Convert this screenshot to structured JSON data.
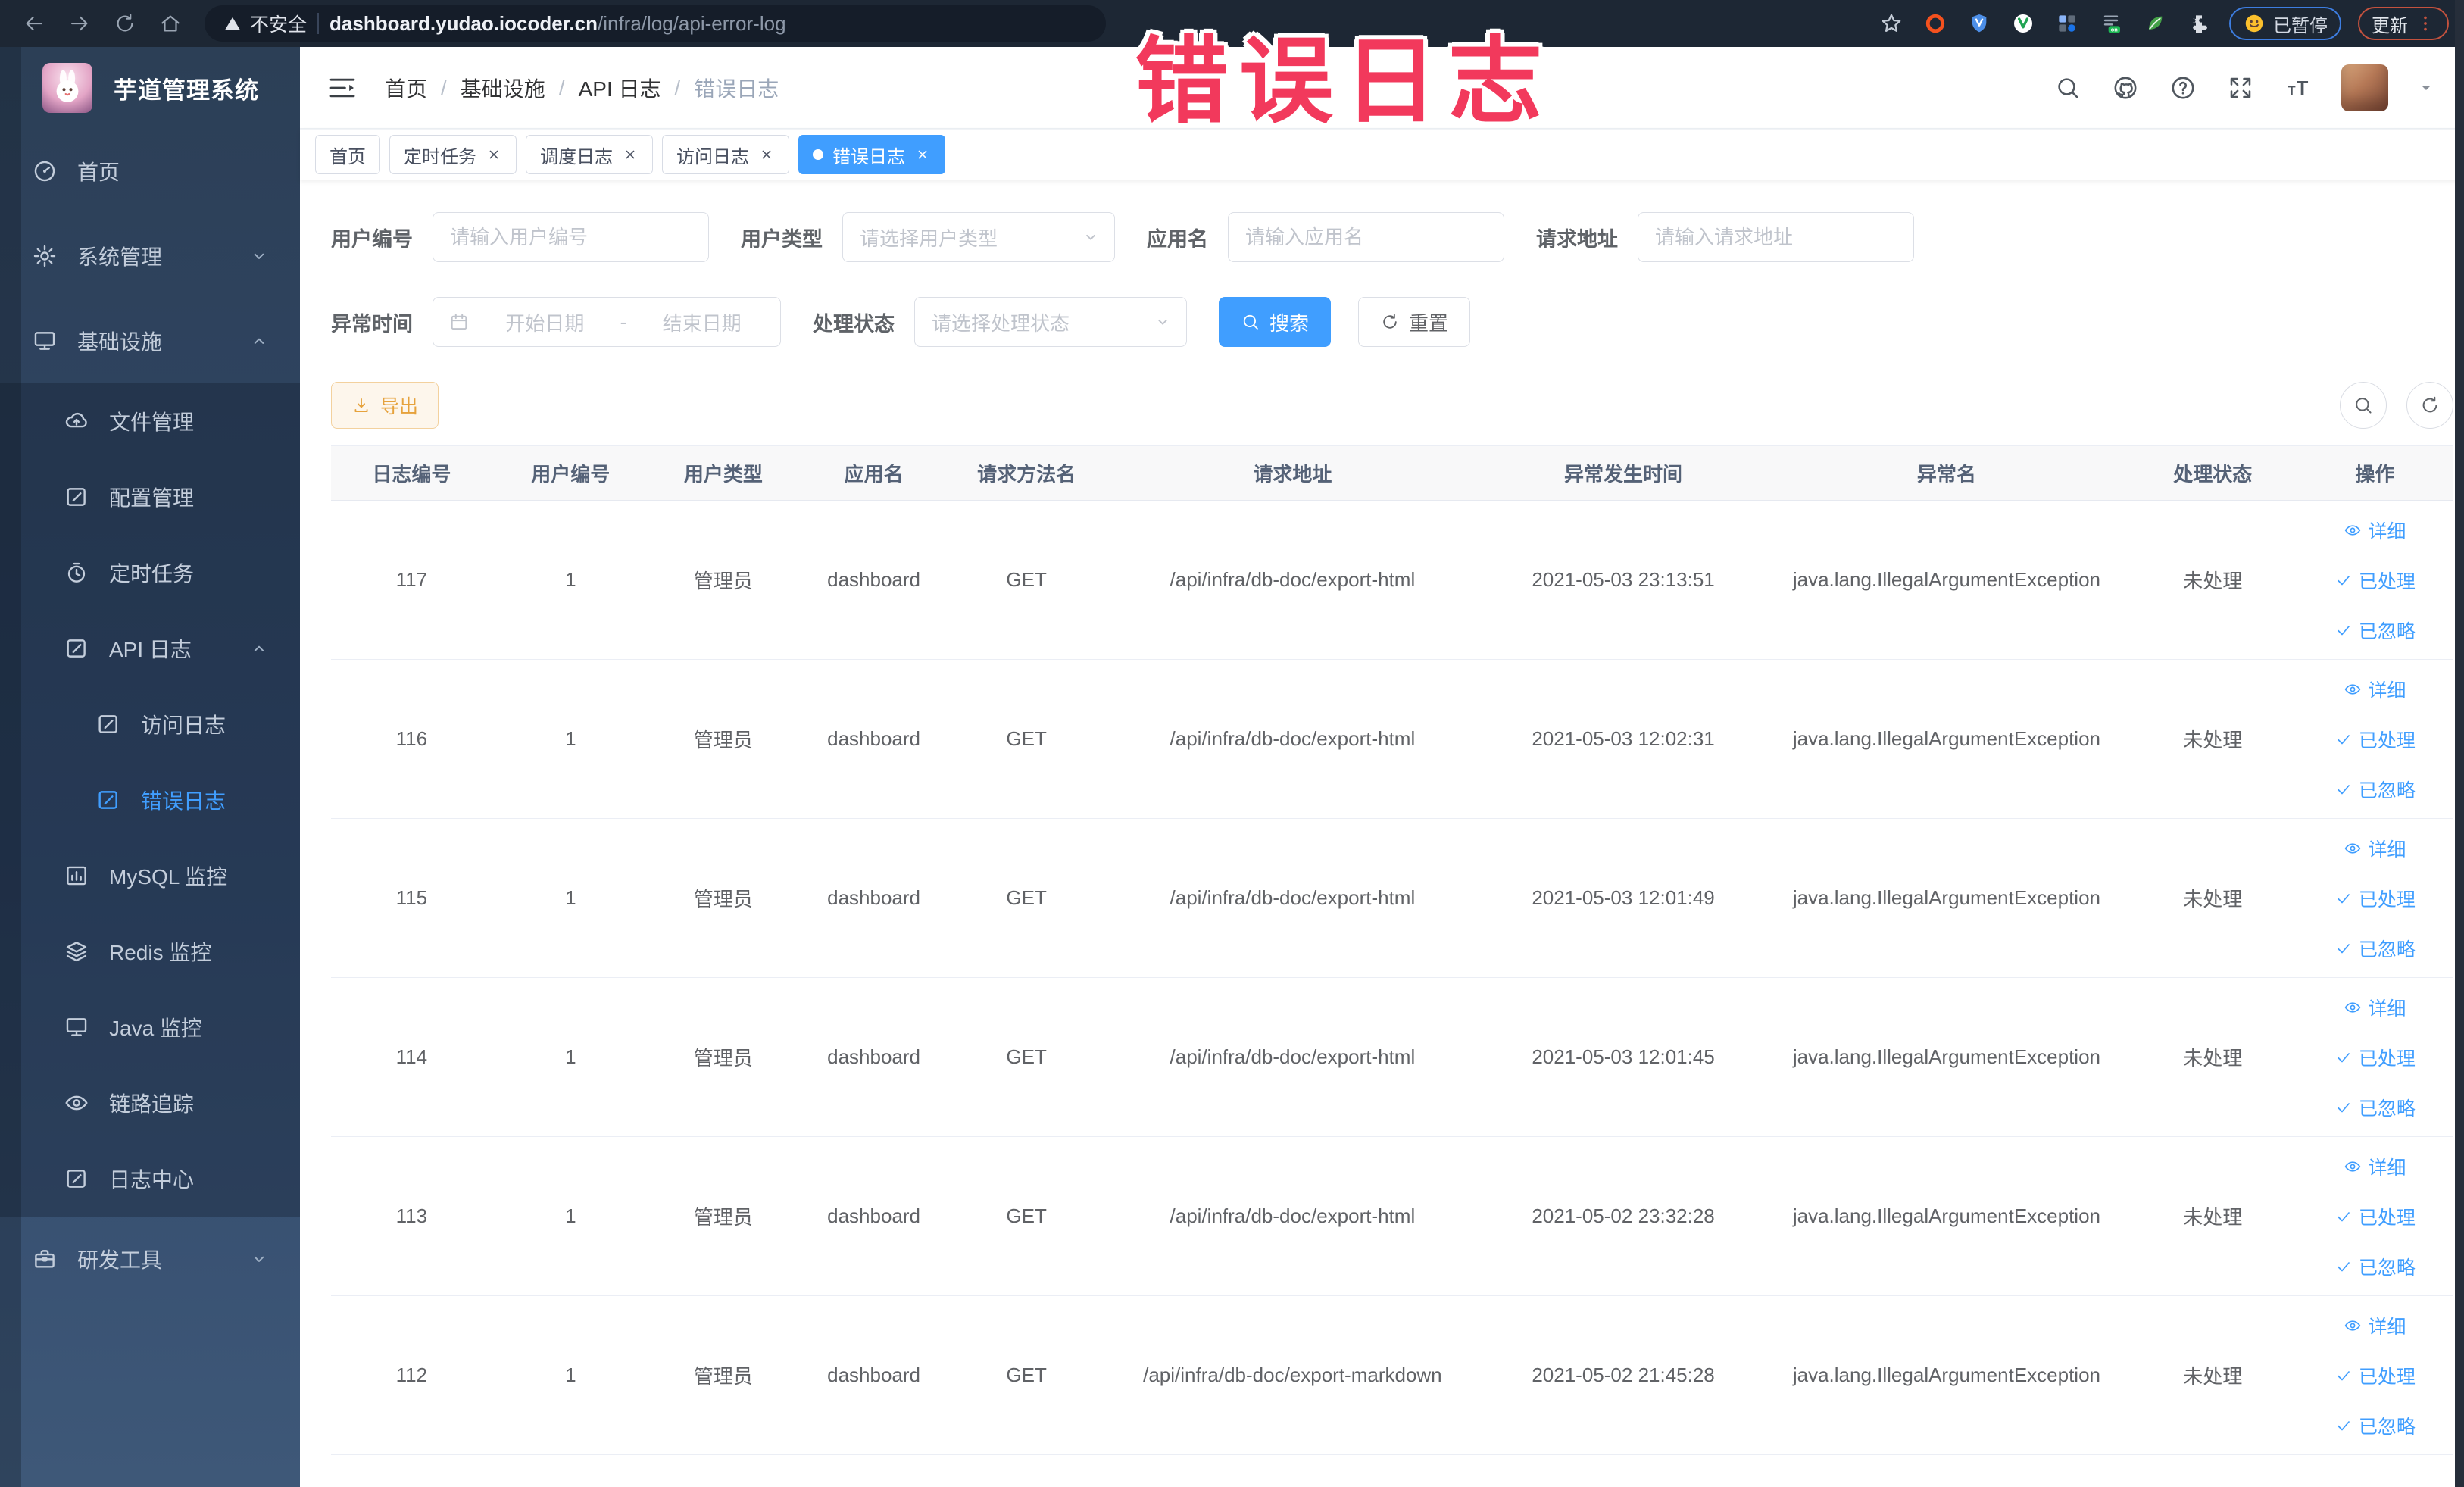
{
  "watermark": {
    "text": "错误日志",
    "color": "#f2395c"
  },
  "browser": {
    "nav_icons": [
      "back-icon",
      "forward-icon",
      "reload-icon",
      "home-icon"
    ],
    "security_label": "不安全",
    "url_domain": "dashboard.yudao.iocoder.cn",
    "url_path": "/infra/log/api-error-log",
    "extensions": [
      {
        "name": "extension-ring-icon",
        "style": "ring-orange"
      },
      {
        "name": "extension-shield-icon",
        "style": "shield-blue"
      },
      {
        "name": "extension-v-icon",
        "style": "circle-green-v"
      },
      {
        "name": "extension-grid-icon",
        "style": "grid-blue"
      },
      {
        "name": "extension-on-icon",
        "style": "on-badge"
      },
      {
        "name": "extension-leaf-icon",
        "style": "leaf-green"
      },
      {
        "name": "extension-puzzle-icon",
        "style": "puzzle-light"
      }
    ],
    "paused_label": "已暂停",
    "update_label": "更新"
  },
  "sidebar": {
    "title": "芋道管理系统",
    "items": [
      {
        "label": "首页",
        "icon": "home-icon",
        "level": 1
      },
      {
        "label": "系统管理",
        "icon": "gear-icon",
        "level": 1,
        "chevron": "down"
      },
      {
        "label": "基础设施",
        "icon": "monitor-icon",
        "level": 1,
        "chevron": "up"
      },
      {
        "label": "文件管理",
        "icon": "cloud-icon",
        "level": 2,
        "section": "sub"
      },
      {
        "label": "配置管理",
        "icon": "edit-icon",
        "level": 2,
        "section": "sub"
      },
      {
        "label": "定时任务",
        "icon": "timer-icon",
        "level": 2,
        "section": "sub"
      },
      {
        "label": "API 日志",
        "icon": "edit-icon",
        "level": 2,
        "section": "sub",
        "chevron": "up"
      },
      {
        "label": "访问日志",
        "icon": "edit-icon",
        "level": 3,
        "section": "sub"
      },
      {
        "label": "错误日志",
        "icon": "edit-icon",
        "level": 3,
        "section": "sub",
        "active": true
      },
      {
        "label": "MySQL 监控",
        "icon": "chart-icon",
        "level": 2,
        "section": "sub"
      },
      {
        "label": "Redis 监控",
        "icon": "layers-icon",
        "level": 2,
        "section": "sub"
      },
      {
        "label": "Java 监控",
        "icon": "monitor-icon",
        "level": 2,
        "section": "sub"
      },
      {
        "label": "链路追踪",
        "icon": "eye-icon",
        "level": 2,
        "section": "sub"
      },
      {
        "label": "日志中心",
        "icon": "edit-icon",
        "level": 2,
        "section": "sub"
      },
      {
        "label": "研发工具",
        "icon": "toolbox-icon",
        "level": 1,
        "chevron": "down"
      }
    ]
  },
  "topbar": {
    "breadcrumb": [
      "首页",
      "基础设施",
      "API 日志",
      "错误日志"
    ],
    "icons": [
      "search-icon",
      "github-icon",
      "help-icon",
      "fullscreen-icon",
      "font-size-icon"
    ]
  },
  "tags": [
    {
      "label": "首页",
      "closable": false,
      "active": false
    },
    {
      "label": "定时任务",
      "closable": true,
      "active": false
    },
    {
      "label": "调度日志",
      "closable": true,
      "active": false
    },
    {
      "label": "访问日志",
      "closable": true,
      "active": false
    },
    {
      "label": "错误日志",
      "closable": true,
      "active": true
    }
  ],
  "filters": {
    "user_id": {
      "label": "用户编号",
      "placeholder": "请输入用户编号"
    },
    "user_type": {
      "label": "用户类型",
      "placeholder": "请选择用户类型"
    },
    "app_name": {
      "label": "应用名",
      "placeholder": "请输入应用名"
    },
    "request_url": {
      "label": "请求地址",
      "placeholder": "请输入请求地址"
    },
    "exception_time": {
      "label": "异常时间",
      "start_placeholder": "开始日期",
      "separator": "-",
      "end_placeholder": "结束日期"
    },
    "process_status": {
      "label": "处理状态",
      "placeholder": "请选择处理状态"
    },
    "search_button": "搜索",
    "reset_button": "重置"
  },
  "toolbar": {
    "export_button": "导出"
  },
  "table": {
    "columns": [
      "日志编号",
      "用户编号",
      "用户类型",
      "应用名",
      "请求方法名",
      "请求地址",
      "异常发生时间",
      "异常名",
      "处理状态",
      "操作"
    ],
    "action_labels": {
      "detail": "详细",
      "processed": "已处理",
      "ignored": "已忽略"
    },
    "rows": [
      {
        "id": "117",
        "user_id": "1",
        "user_type": "管理员",
        "app": "dashboard",
        "method": "GET",
        "url": "/api/infra/db-doc/export-html",
        "time": "2021-05-03 23:13:51",
        "exception": "java.lang.IllegalArgumentException",
        "status": "未处理"
      },
      {
        "id": "116",
        "user_id": "1",
        "user_type": "管理员",
        "app": "dashboard",
        "method": "GET",
        "url": "/api/infra/db-doc/export-html",
        "time": "2021-05-03 12:02:31",
        "exception": "java.lang.IllegalArgumentException",
        "status": "未处理"
      },
      {
        "id": "115",
        "user_id": "1",
        "user_type": "管理员",
        "app": "dashboard",
        "method": "GET",
        "url": "/api/infra/db-doc/export-html",
        "time": "2021-05-03 12:01:49",
        "exception": "java.lang.IllegalArgumentException",
        "status": "未处理"
      },
      {
        "id": "114",
        "user_id": "1",
        "user_type": "管理员",
        "app": "dashboard",
        "method": "GET",
        "url": "/api/infra/db-doc/export-html",
        "time": "2021-05-03 12:01:45",
        "exception": "java.lang.IllegalArgumentException",
        "status": "未处理"
      },
      {
        "id": "113",
        "user_id": "1",
        "user_type": "管理员",
        "app": "dashboard",
        "method": "GET",
        "url": "/api/infra/db-doc/export-html",
        "time": "2021-05-02 23:32:28",
        "exception": "java.lang.IllegalArgumentException",
        "status": "未处理"
      },
      {
        "id": "112",
        "user_id": "1",
        "user_type": "管理员",
        "app": "dashboard",
        "method": "GET",
        "url": "/api/infra/db-doc/export-markdown",
        "time": "2021-05-02 21:45:28",
        "exception": "java.lang.IllegalArgumentException",
        "status": "未处理"
      }
    ]
  }
}
